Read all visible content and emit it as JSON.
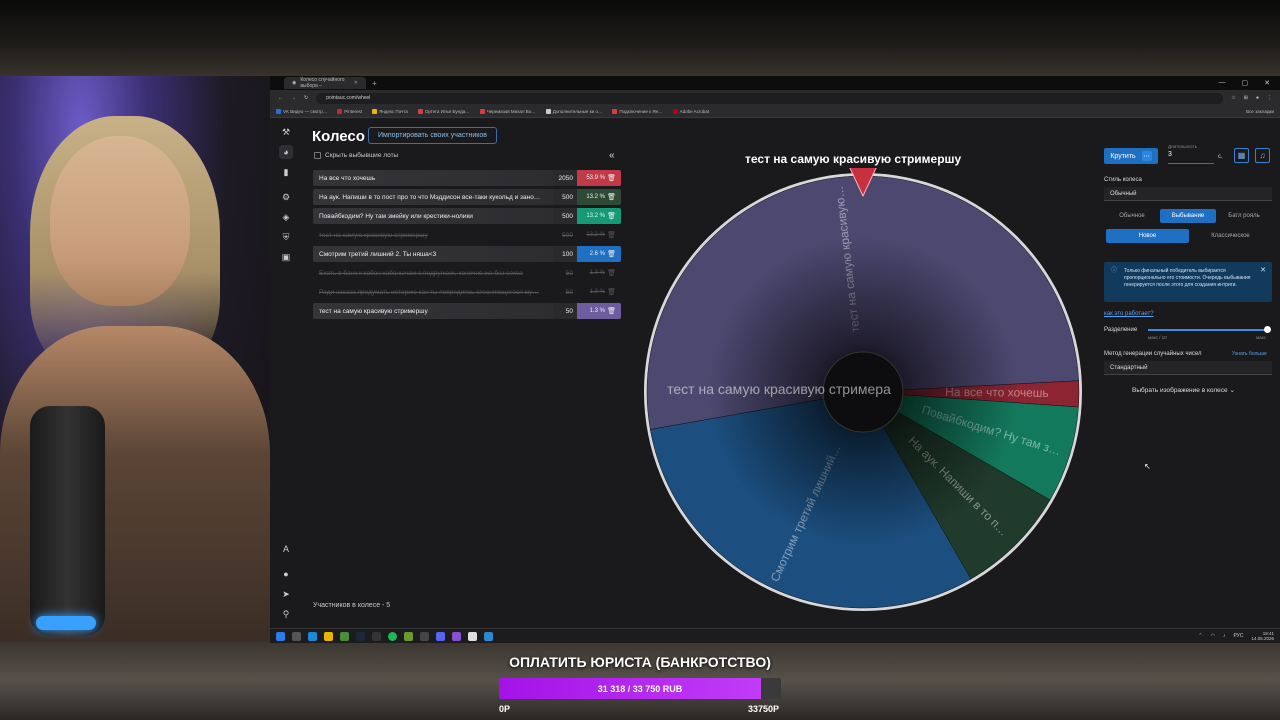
{
  "browser": {
    "tab_title": "Колесо случайного выбора –",
    "url": "pointauc.com/wheel",
    "bookmarks": [
      "VK Видео — смотр…",
      "Pinterest",
      "Яндекс Почта",
      "Ортега Илья Бунда…",
      "Черемазов Михал Во…",
      "Дополнительные ки о…",
      "Подключение к Ян…",
      "Adobe Acrobat"
    ],
    "bookmarks_right": "Все закладки"
  },
  "app": {
    "title": "Колесо",
    "import_label": "Импортировать своих участников",
    "hide_lots_label": "Скрыть выбывшие лоты",
    "lots": [
      {
        "name": "На все что хочешь",
        "amount": "2050",
        "percent": "53.9 %",
        "color": "#c23a4a",
        "active": true
      },
      {
        "name": "На аук. Напиши в то пост про то что Мэддисон все-таки кукольд и зано…",
        "amount": "500",
        "percent": "13.2 %",
        "color": "#2e4a36",
        "active": true
      },
      {
        "name": "Повайбкодим? Ну там змейку или крестики-нолики",
        "amount": "500",
        "percent": "13.2 %",
        "color": "#149a74",
        "active": true
      },
      {
        "name": "тест на самую красивую стримершу",
        "amount": "500",
        "percent": "13.2 %",
        "color": "#333",
        "active": false
      },
      {
        "name": "Смотрим третий лишний 2. Ты няша<3",
        "amount": "100",
        "percent": "2.6 %",
        "color": "#1f6fc3",
        "active": true
      },
      {
        "name": "Ехать в банк к кабан кабанычам с подругкэкк, конечно же без секса",
        "amount": "50",
        "percent": "1.3 %",
        "color": "#333",
        "active": false
      },
      {
        "name": "Ради заказа продумать историю как ты повредиясь стесняющегося му…",
        "amount": "50",
        "percent": "1.3 %",
        "color": "#333",
        "active": false
      },
      {
        "name": "тест на самую красивую стримершу",
        "amount": "50",
        "percent": "1.3 %",
        "color": "#6b5d9e",
        "active": true
      }
    ],
    "participants_label": "Участников в колесе - 5",
    "wheel_title": "тест на самую красивую стримершу",
    "wheel_center_text": "тест на самую красивую стримера",
    "wheel_segments": [
      {
        "label": "тест на самую красивую…",
        "color": "#4d4870"
      },
      {
        "label": "На все что хочешь",
        "color": "#8c2432"
      },
      {
        "label": "Повайбкодим? Ну там з…",
        "color": "#13795c"
      },
      {
        "label": "На аук. Напиши в то п…",
        "color": "#203a2c"
      },
      {
        "label": "Смотрим третий лишний…",
        "color": "#1c4f80"
      }
    ]
  },
  "panel": {
    "spin_label": "Крутить",
    "duration_label": "Длительность",
    "duration_value": "3",
    "duration_unit": "с.",
    "wheel_style_label": "Стиль колеса",
    "wheel_style_value": "Обычный",
    "modes": [
      "Обычное",
      "Выбывание",
      "Батл рояль"
    ],
    "submodes": [
      "Новое",
      "Классическое"
    ],
    "info_text": "Только финальный победитель выбирается пропорционально его стоимости. Очередь выбывания генерируется после этого для создания интриги.",
    "how_link": "как это работает?",
    "split_label": "Разделение",
    "split_min": "макс / 10",
    "split_max": "макс",
    "rng_label": "Метод генерации случайных чисел",
    "rng_link": "Узнать больше",
    "rng_value": "Стандартный",
    "image_label": "Выбрать изображение в колесе"
  },
  "taskbar": {
    "lang": "РУС",
    "time": "19:41",
    "date": "14.05.2026"
  },
  "goal": {
    "title": "ОПЛАТИТЬ ЮРИСТА (БАНКРОТСТВО)",
    "progress_text": "31 318 / 33 750 RUB",
    "progress_fraction": 0.928,
    "min_label": "0Р",
    "max_label": "33750Р"
  }
}
